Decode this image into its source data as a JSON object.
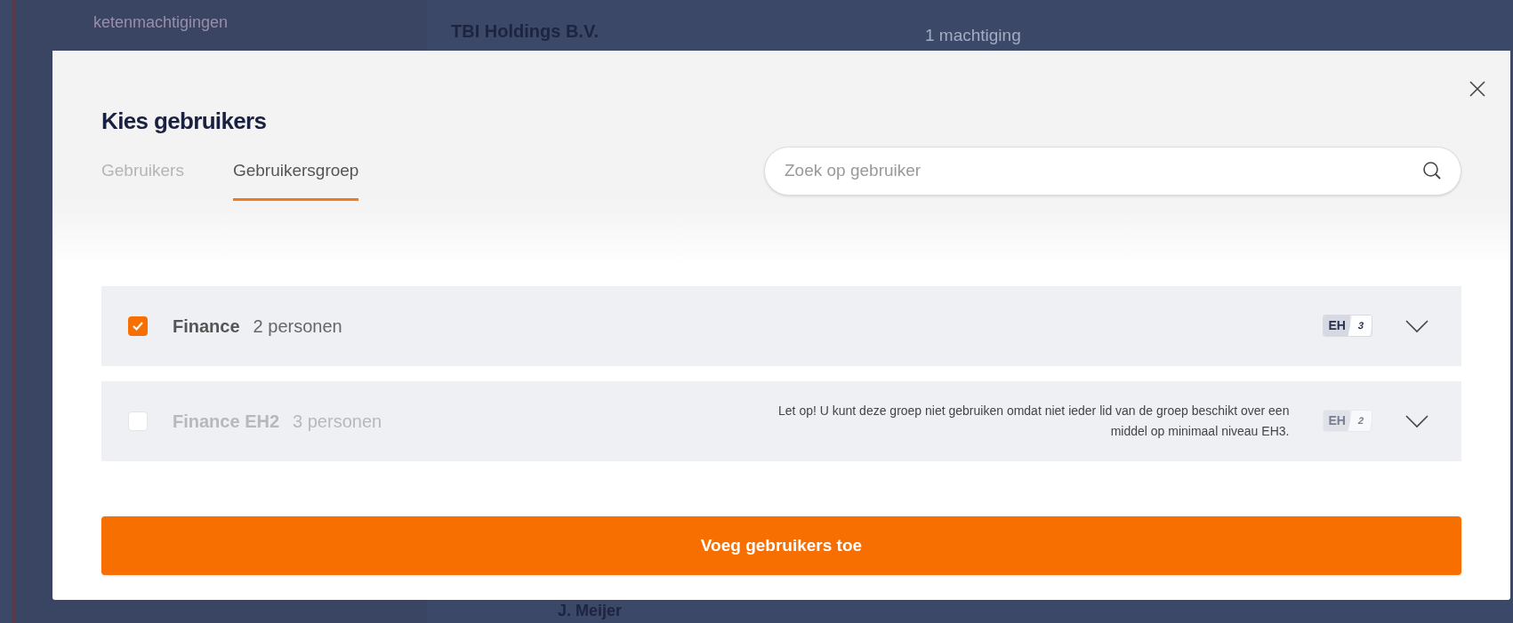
{
  "background": {
    "sidebar_item": "ketenmachtigingen",
    "company": "TBI Holdings B.V.",
    "count": "1 machtiging",
    "user": "J. Meijer"
  },
  "dialog": {
    "title": "Kies gebruikers",
    "tabs": [
      {
        "label": "Gebruikers",
        "selected": false
      },
      {
        "label": "Gebruikersgroep",
        "selected": true
      }
    ],
    "search": {
      "placeholder": "Zoek op gebruiker"
    },
    "groups": [
      {
        "name": "Finance",
        "count": "2 personen",
        "checked": true,
        "disabled": false,
        "badge_label": "EH",
        "badge_level": "3",
        "expanded": false
      },
      {
        "name": "Finance EH2",
        "count": "3 personen",
        "checked": false,
        "disabled": true,
        "warning": "Let op! U kunt deze groep niet gebruiken omdat niet ieder lid van de groep beschikt over een middel op minimaal niveau EH3.",
        "badge_label": "EH",
        "badge_level": "2",
        "expanded": false
      }
    ],
    "button": "Voeg gebruikers toe"
  }
}
